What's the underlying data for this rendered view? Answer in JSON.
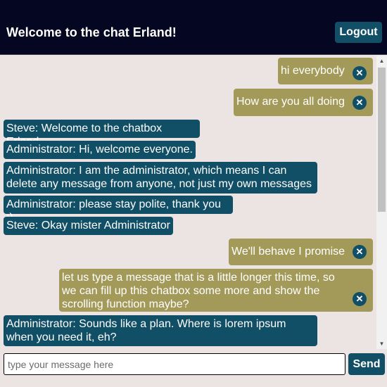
{
  "header": {
    "title": "Welcome to the chat Erland!",
    "logout_label": "Logout"
  },
  "messages": [
    {
      "own": true,
      "text": "hi everybody"
    },
    {
      "own": true,
      "text": "How are you all doing"
    },
    {
      "own": false,
      "text": "Steve: Welcome to the chatbox Erland"
    },
    {
      "own": false,
      "text": "Administrator: Hi, welcome everyone."
    },
    {
      "own": false,
      "text": "Administrator: I am the administrator, which means I can delete any message from anyone, not just my own messages"
    },
    {
      "own": false,
      "text": "Administrator: please stay polite, thank you :)"
    },
    {
      "own": false,
      "text": "Steve: Okay mister Administrator"
    },
    {
      "own": true,
      "text": "We'll behave I promise"
    },
    {
      "own": true,
      "text": "let us type a message that is a little longer this time, so we can fill up this chatbox some more and show the scrolling function maybe?"
    },
    {
      "own": false,
      "text": "Administrator: Sounds like a plan. Where is lorem ipsum when you need it, eh?"
    },
    {
      "own": false,
      "text": ""
    }
  ],
  "composer": {
    "placeholder": "type your message here",
    "value": "",
    "send_label": "Send"
  },
  "icons": {
    "delete": "close-icon",
    "scroll_up": "chevron-up-icon",
    "scroll_down": "chevron-down-icon"
  },
  "colors": {
    "header_bg": "#050722",
    "accent": "#114f66",
    "own_message_bg": "#a39a5a",
    "chat_bg": "#ece3e3"
  }
}
